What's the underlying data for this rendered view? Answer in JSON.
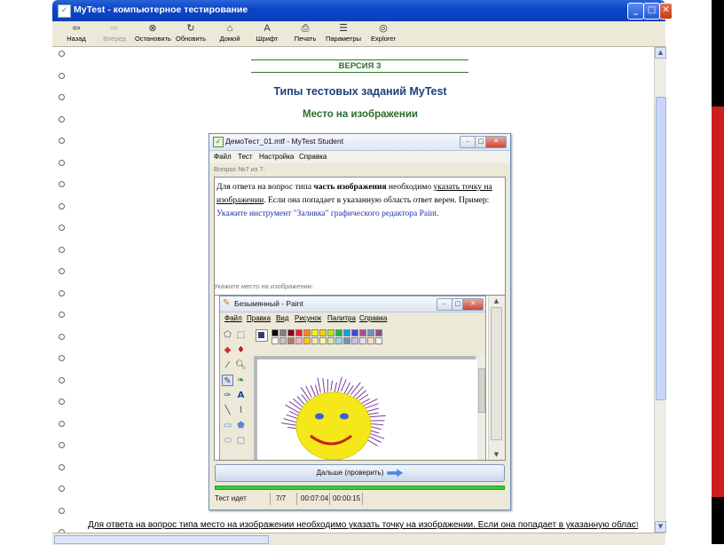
{
  "window": {
    "title": "MyTest - компьютерное тестирование",
    "buttons": {
      "minimize": "_",
      "maximize": "□",
      "close": "✕"
    }
  },
  "toolbar": {
    "items": [
      {
        "label": "Назад",
        "icon": "back-arrow-icon",
        "glyph": "⇦",
        "enabled": true
      },
      {
        "label": "Вперед",
        "icon": "forward-arrow-icon",
        "glyph": "⇨",
        "enabled": false
      },
      {
        "label": "Остановить",
        "icon": "stop-icon",
        "glyph": "⊗",
        "enabled": true
      },
      {
        "label": "Обновить",
        "icon": "refresh-icon",
        "glyph": "↻",
        "enabled": true
      },
      {
        "label": "Домой",
        "icon": "home-icon",
        "glyph": "⌂",
        "enabled": true
      },
      {
        "label": "Шрифт",
        "icon": "font-icon",
        "glyph": "A",
        "enabled": true
      },
      {
        "label": "Печать",
        "icon": "print-icon",
        "glyph": "⎙",
        "enabled": true
      },
      {
        "label": "Параметры",
        "icon": "settings-icon",
        "glyph": "☰",
        "enabled": true
      },
      {
        "label": "Explorer",
        "icon": "explorer-icon",
        "glyph": "◎",
        "enabled": true
      }
    ]
  },
  "document": {
    "version": "ВЕРСИЯ 3",
    "title": "Типы тестовых заданий MyTest",
    "subtitle": "Место на изображении",
    "bottom_text": "Для ответа на вопрос типа место на изображении необходимо указать точку на изображении. Если она попадает в указанную область"
  },
  "mytest": {
    "title": "ДемоТест_01.mtf - MyTest Student",
    "menu": [
      "Файл",
      "Тест",
      "Настройка",
      "Справка"
    ],
    "question_header": "Вопрос №7 из 7:",
    "question": {
      "p1": "Для ответа на вопрос типа ",
      "p2": "часть изображения",
      "p3": " необходимо ",
      "p4": "указать точку на изображении",
      "p5": ". Если она попадает в указанную область ответ верен. Пример:",
      "p6": "Укажите инструмент \"Заливка\" графического редактора Paint."
    },
    "pick_label": "Укажите место на изображении:",
    "next_button": "Дальше (проверить)",
    "status": {
      "state": "Тест идет",
      "count": "7/7",
      "elapsed": "00:07:04",
      "remaining": "00:00:15"
    }
  },
  "paint": {
    "title": "Безымянный - Paint",
    "menu": [
      "Файл",
      "Правка",
      "Вид",
      "Рисунок",
      "Палитра",
      "Справка"
    ],
    "palette_top": [
      "#000000",
      "#808080",
      "#800000",
      "#808000",
      "#008000",
      "#008080",
      "#000080",
      "#800080",
      "#808040",
      "#004040",
      "#0080ff",
      "#004080",
      "#4000ff",
      "#804000"
    ],
    "palette_row1": [
      "#000000",
      "#7f7f7f",
      "#880015",
      "#ed1c24",
      "#ff7f27",
      "#fff200",
      "#ffc90e",
      "#b5e61d",
      "#22b14c",
      "#00a2e8",
      "#3f48cc",
      "#a349a4",
      "#7092be",
      "#8e4b8e"
    ],
    "palette_row2": [
      "#ffffff",
      "#c3c3c3",
      "#b97a57",
      "#ffaec9",
      "#ffc90e",
      "#efe4b0",
      "#fff8a0",
      "#d0f0a0",
      "#99d9ea",
      "#7092be",
      "#c8bfe7",
      "#e0e0ff",
      "#ffe0c0",
      "#f0f0f0"
    ]
  }
}
